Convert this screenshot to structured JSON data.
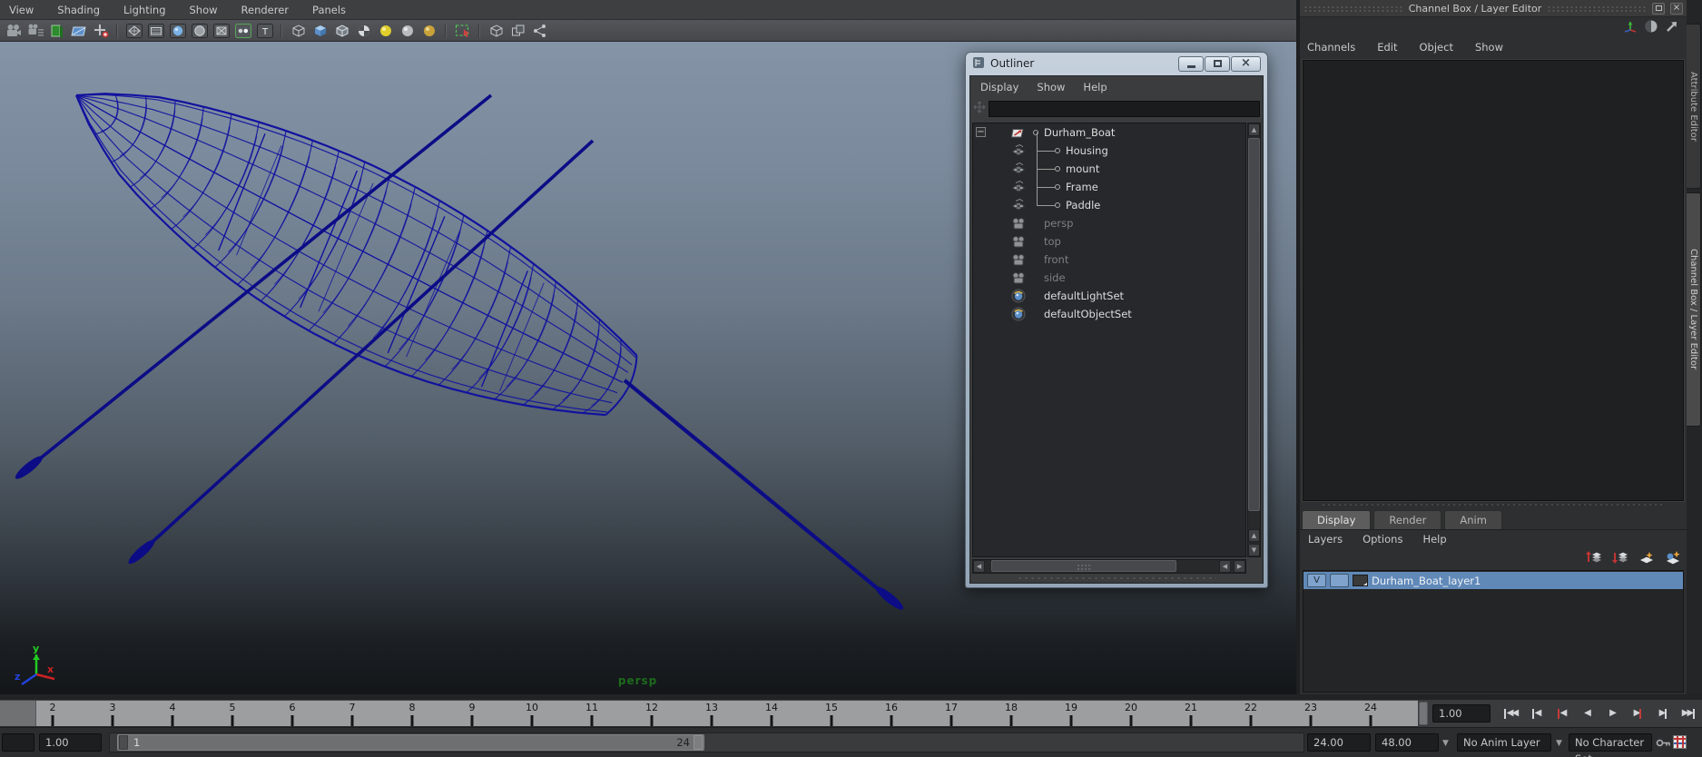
{
  "viewport_panel": {
    "menu": [
      "View",
      "Shading",
      "Lighting",
      "Show",
      "Renderer",
      "Panels"
    ],
    "camera_label": "persp",
    "axis_labels": {
      "x": "x",
      "y": "y",
      "z": "z"
    },
    "toolbar_icons": [
      "camera",
      "camera-settings",
      "bookmark",
      "image-plane",
      "pan-zoom",
      "sep",
      "wireframe",
      "film-gate",
      "smooth-shade",
      "flat-shade",
      "textured",
      "lights",
      "default-material",
      "sep",
      "cube-wire",
      "cube-blue",
      "cube-glass",
      "ball-check",
      "ball-yellow",
      "ball-gray",
      "ball-gold",
      "sep",
      "isolate-select",
      "sep",
      "xray",
      "copy",
      "share"
    ]
  },
  "outliner": {
    "title": "Outliner",
    "menu": [
      "Display",
      "Show",
      "Help"
    ],
    "search_value": "",
    "items": [
      {
        "label": "Durham_Boat",
        "type": "transform"
      },
      {
        "label": "Housing",
        "type": "mesh"
      },
      {
        "label": "mount",
        "type": "mesh"
      },
      {
        "label": "Frame",
        "type": "mesh"
      },
      {
        "label": "Paddle",
        "type": "mesh"
      },
      {
        "label": "persp",
        "type": "camera"
      },
      {
        "label": "top",
        "type": "camera"
      },
      {
        "label": "front",
        "type": "camera"
      },
      {
        "label": "side",
        "type": "camera"
      },
      {
        "label": "defaultLightSet",
        "type": "set"
      },
      {
        "label": "defaultObjectSet",
        "type": "set"
      }
    ]
  },
  "right_dock": {
    "header_title": "Channel Box / Layer Editor",
    "menu": [
      "Channels",
      "Edit",
      "Object",
      "Show"
    ],
    "side_tabs": [
      "Attribute Editor",
      "Channel Box / Layer Editor"
    ],
    "layer_editor": {
      "tabs": [
        "Display",
        "Render",
        "Anim"
      ],
      "active_tab": "Display",
      "menu": [
        "Layers",
        "Options",
        "Help"
      ],
      "layers": [
        {
          "visibility": "V",
          "name": "Durham_Boat_layer1",
          "selected": true
        }
      ]
    }
  },
  "timeline": {
    "ticks": [
      "2",
      "3",
      "4",
      "5",
      "6",
      "7",
      "8",
      "9",
      "10",
      "11",
      "12",
      "13",
      "14",
      "15",
      "16",
      "17",
      "18",
      "19",
      "20",
      "21",
      "22",
      "23",
      "24"
    ],
    "current_frame": "1",
    "current_time": "1.00"
  },
  "playback": {
    "buttons": [
      {
        "name": "go-to-start",
        "bar": "left",
        "arrows": "◀◀",
        "red": false
      },
      {
        "name": "step-back-frame",
        "bar": "left",
        "arrows": "◀",
        "red": false
      },
      {
        "name": "step-back-key",
        "bar": "left",
        "arrows": "◀",
        "red": true
      },
      {
        "name": "play-backwards",
        "bar": "none",
        "arrows": "◀",
        "red": false
      },
      {
        "name": "play-forwards",
        "bar": "none",
        "arrows": "▶",
        "red": false
      },
      {
        "name": "step-forward-key",
        "bar": "right",
        "arrows": "▶",
        "red": true
      },
      {
        "name": "step-forward-frame",
        "bar": "right",
        "arrows": "▶",
        "red": false
      },
      {
        "name": "go-to-end",
        "bar": "right",
        "arrows": "▶▶",
        "red": false
      }
    ]
  },
  "range_bar": {
    "anim_start_value": "",
    "playback_start_value": "1.00",
    "range_start_label": "1",
    "range_end_label": "24",
    "playback_end_value": "24.00",
    "anim_end_value": "48.00",
    "anim_layer_value": "No Anim Layer",
    "character_set_value": "No Character Set"
  },
  "colors": {
    "wireframe": "#12129e",
    "wireframe_dark": "#0c0c86",
    "selected_layer": "#6089b8",
    "persp_label": "#1c6b1c"
  }
}
